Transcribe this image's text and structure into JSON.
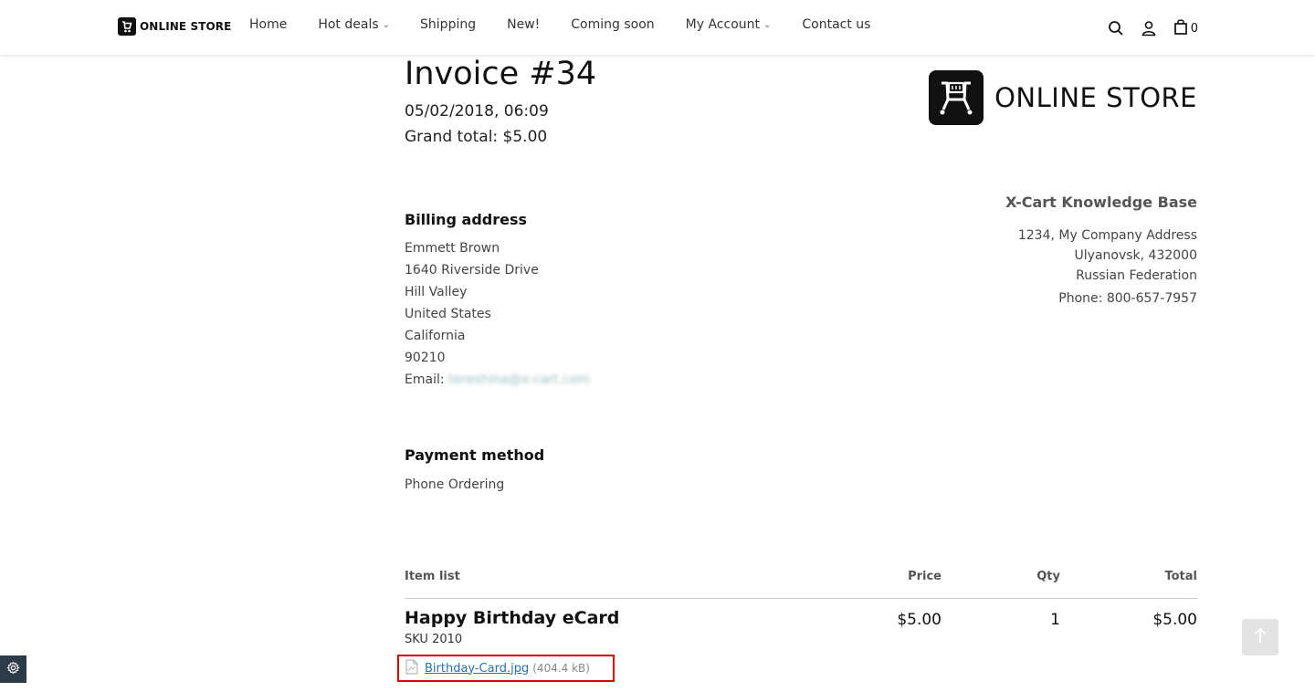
{
  "header": {
    "logo_text": "ONLINE STORE",
    "nav": [
      {
        "label": "Home",
        "has_dropdown": false
      },
      {
        "label": "Hot deals",
        "has_dropdown": true
      },
      {
        "label": "Shipping",
        "has_dropdown": false
      },
      {
        "label": "New!",
        "has_dropdown": false
      },
      {
        "label": "Coming soon",
        "has_dropdown": false
      },
      {
        "label": "My Account",
        "has_dropdown": true
      },
      {
        "label": "Contact us",
        "has_dropdown": false
      }
    ],
    "icons": [
      "search-icon",
      "user-icon",
      "cart-icon"
    ],
    "cart_count": "0"
  },
  "invoice": {
    "title": "Invoice #34",
    "date": "05/02/2018, 06:09",
    "grand_total": "Grand total: $5.00",
    "logo_text": "ONLINE STORE"
  },
  "billing": {
    "heading": "Billing address",
    "name": "Emmett  Brown",
    "street": "1640 Riverside Drive",
    "city": "Hill Valley",
    "country": "United States",
    "state": "California",
    "zip": "90210",
    "email_label": "Email:",
    "email_value": "tereshina@x-cart.com"
  },
  "company": {
    "name": "X-Cart Knowledge Base",
    "address": "1234, My Company Address",
    "city": "Ulyanovsk, 432000",
    "country": "Russian Federation",
    "phone": "Phone: 800-657-7957"
  },
  "payment": {
    "heading": "Payment method",
    "value": "Phone Ordering"
  },
  "items": {
    "headers": {
      "item": "Item list",
      "price": "Price",
      "qty": "Qty",
      "total": "Total"
    },
    "rows": [
      {
        "name": "Happy Birthday eCard",
        "sku": "SKU 2010",
        "price": "$5.00",
        "qty": "1",
        "total": "$5.00",
        "attachment": {
          "file": "Birthday-Card.jpg",
          "size": "(404.4 kB)"
        }
      }
    ]
  },
  "colors": {
    "highlight_box": "#dd0000",
    "link": "#2a6fb0",
    "settings_bg": "#2d3a48"
  }
}
